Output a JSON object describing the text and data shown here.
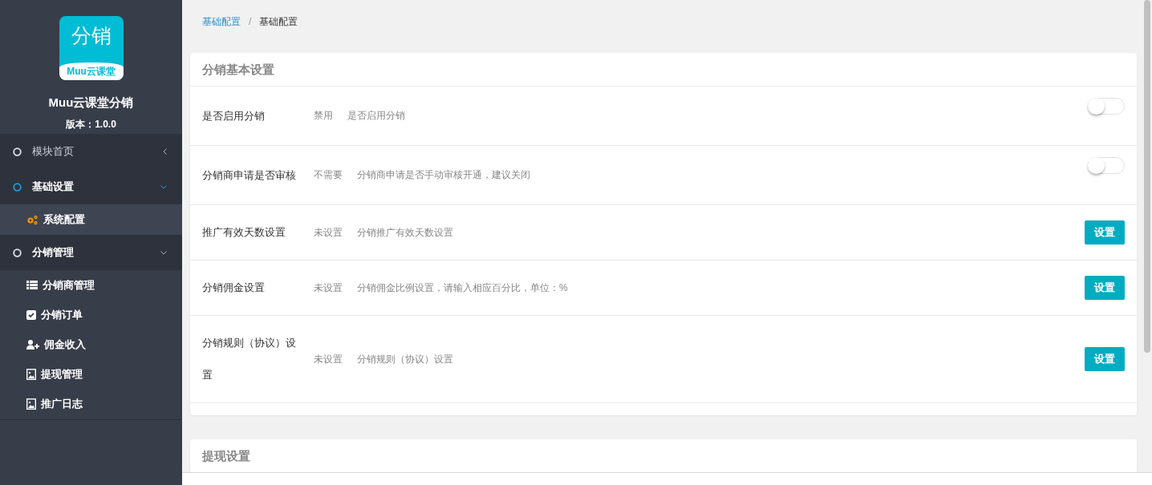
{
  "sidebar": {
    "logo": {
      "title": "分销",
      "subtitle": "Muu云课堂"
    },
    "app_name": "Muu云课堂分销",
    "version": "版本：1.0.0",
    "menu": [
      {
        "label": "模块首页",
        "expanded": false,
        "selected": false
      },
      {
        "label": "基础设置",
        "expanded": true,
        "selected": true,
        "children": [
          {
            "label": "系统配置",
            "selected": true
          }
        ]
      },
      {
        "label": "分销管理",
        "expanded": true,
        "selected": false,
        "children": [
          {
            "label": "分销商管理",
            "selected": false
          },
          {
            "label": "分销订单",
            "selected": false
          },
          {
            "label": "佣金收入",
            "selected": false
          },
          {
            "label": "提现管理",
            "selected": false
          },
          {
            "label": "推广日志",
            "selected": false
          }
        ]
      }
    ]
  },
  "breadcrumb": {
    "items": [
      {
        "label": "基础配置",
        "kind": "link"
      },
      {
        "label": "基础配置",
        "kind": "current"
      }
    ],
    "separator": "/"
  },
  "panels": [
    {
      "title": "分销基本设置",
      "rows": [
        {
          "label": "是否启用分销",
          "value": "禁用",
          "description": "是否启用分销",
          "control": {
            "kind": "switch",
            "on": false
          }
        },
        {
          "label": "分销商申请是否审核",
          "value": "不需要",
          "description": "分销商申请是否手动审核开通，建议关闭",
          "control": {
            "kind": "switch",
            "on": false
          }
        },
        {
          "label": "推广有效天数设置",
          "value": "未设置",
          "description": "分销推广有效天数设置",
          "control": {
            "kind": "button",
            "label": "设置"
          }
        },
        {
          "label": "分销佣金设置",
          "value": "未设置",
          "description": "分销佣金比例设置，请输入相应百分比，单位：%",
          "control": {
            "kind": "button",
            "label": "设置"
          }
        },
        {
          "label": "分销规则（协议）设置",
          "value": "未设置",
          "description": "分销规则（协议）设置",
          "control": {
            "kind": "button",
            "label": "设置"
          }
        }
      ]
    },
    {
      "title": "提现设置"
    }
  ]
}
